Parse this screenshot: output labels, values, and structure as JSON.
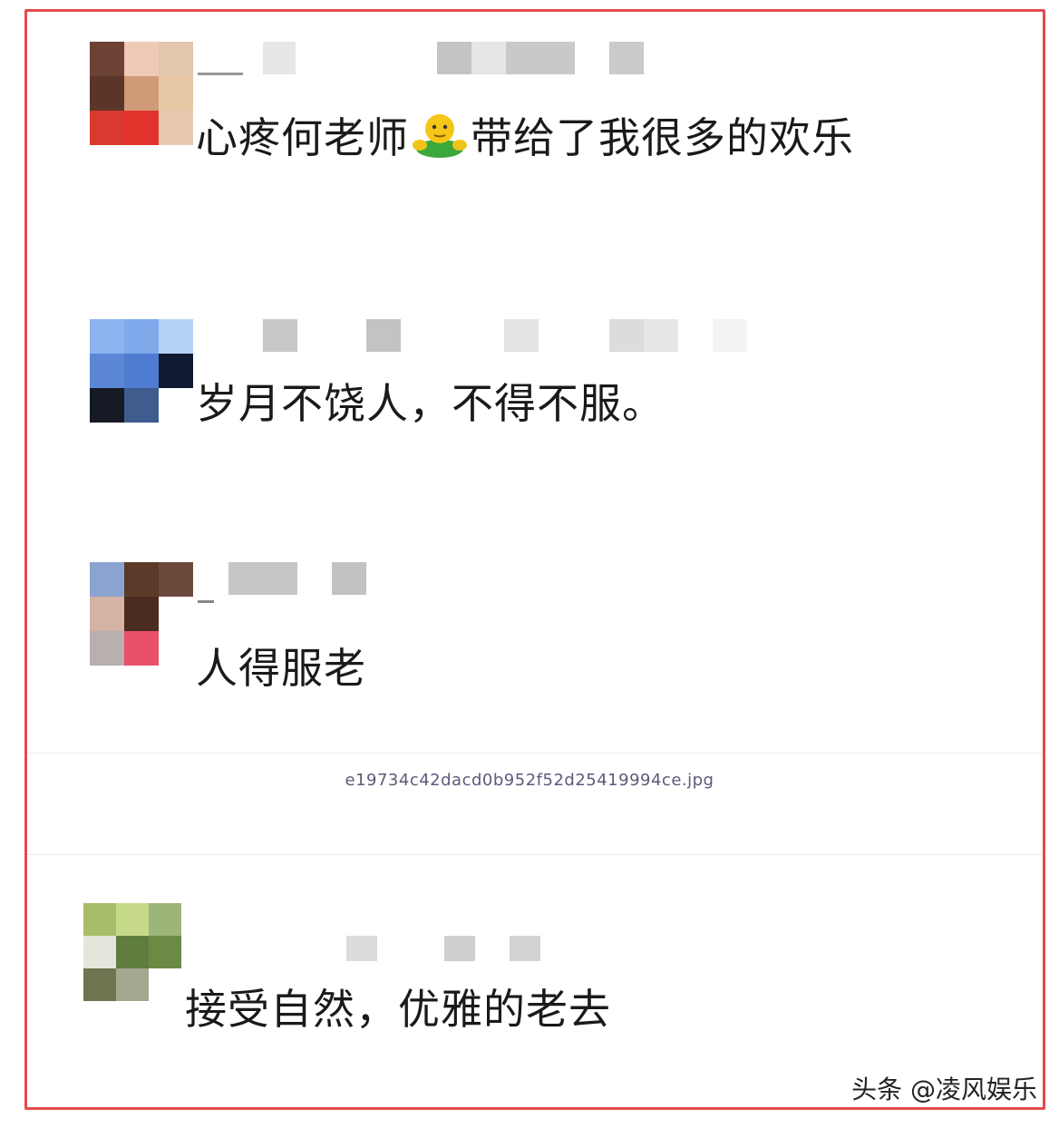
{
  "comments": [
    {
      "text": "心疼何老师",
      "text_after_emoji": "带给了我很多的欢乐"
    },
    {
      "text": "岁月不饶人，不得不服。"
    },
    {
      "text": "人得服老"
    },
    {
      "text": "接受自然，优雅的老去"
    }
  ],
  "caption": "e19734c42dacd0b952f52d25419994ce.jpg",
  "watermark": "头条 @凌风娱乐",
  "colors": {
    "frame": "#e24b4b",
    "text": "#1a1a1a"
  }
}
